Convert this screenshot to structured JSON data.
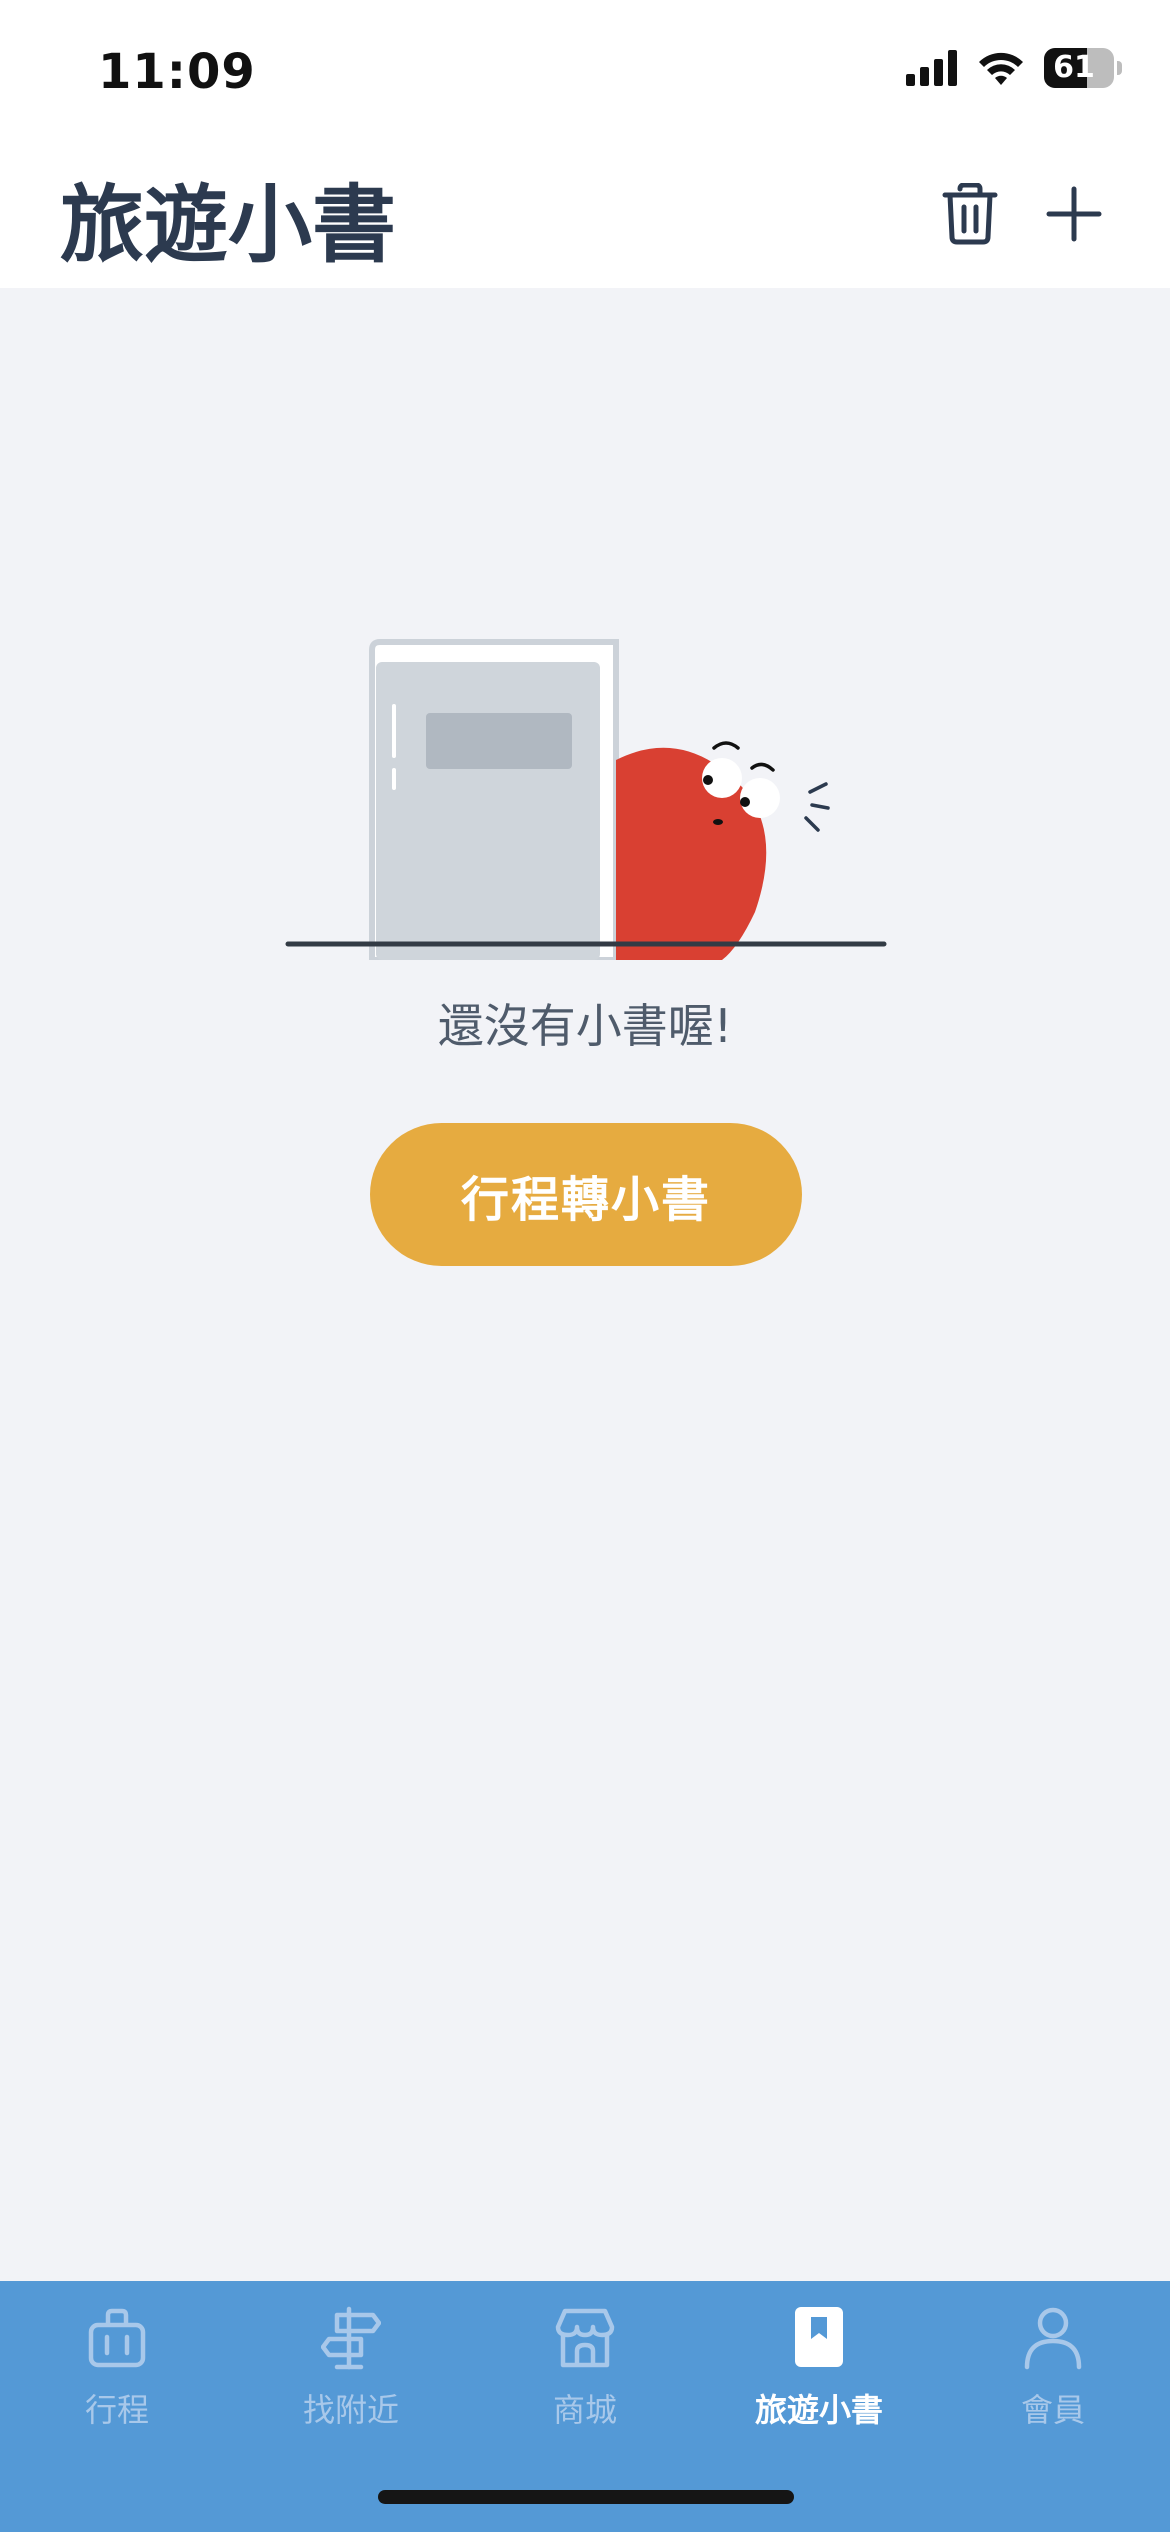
{
  "status_bar": {
    "time": "11:09",
    "battery": "61"
  },
  "header": {
    "title": "旅遊小書"
  },
  "empty_state": {
    "message": "還沒有小書喔!",
    "button_label": "行程轉小書"
  },
  "tabs": [
    {
      "label": "行程",
      "icon": "suitcase-icon",
      "active": false
    },
    {
      "label": "找附近",
      "icon": "signpost-icon",
      "active": false
    },
    {
      "label": "商城",
      "icon": "store-icon",
      "active": false
    },
    {
      "label": "旅遊小書",
      "icon": "book-icon",
      "active": true
    },
    {
      "label": "會員",
      "icon": "person-icon",
      "active": false
    }
  ],
  "colors": {
    "header_text": "#2c3a4f",
    "accent_button": "#e6ab40",
    "tab_bar": "#5499d6",
    "tab_inactive": "#a8c8ea",
    "tab_active": "#ffffff",
    "mascot": "#d94032"
  }
}
